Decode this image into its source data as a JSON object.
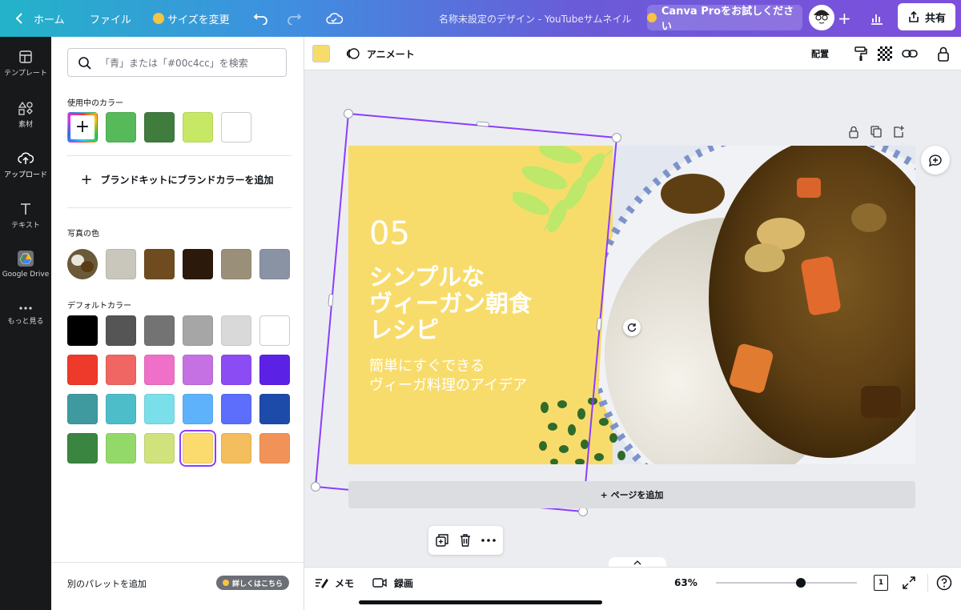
{
  "topbar": {
    "home_label": "ホーム",
    "file_label": "ファイル",
    "resize_label": "サイズを変更",
    "doc_title": "名称未設定のデザイン - YouTubeサムネイル",
    "pro_label": "Canva Proをお試しください",
    "share_label": "共有"
  },
  "leftnav": {
    "items": [
      {
        "label": "テンプレート"
      },
      {
        "label": "素材"
      },
      {
        "label": "アップロード"
      },
      {
        "label": "テキスト"
      },
      {
        "label": "Google Drive"
      },
      {
        "label": "もっと見る"
      }
    ]
  },
  "panel": {
    "search_placeholder": "「青」または「#00c4cc」を検索",
    "in_use_title": "使用中のカラー",
    "in_use_colors": [
      "#56b95a",
      "#3f7c3e",
      "#c7e865",
      "#ffffff"
    ],
    "brand_label": "ブランドキットにブランドカラーを追加",
    "photo_title": "写真の色",
    "photo_colors": [
      "#c9c6bc",
      "#6f4c1f",
      "#2b1a0c",
      "#9a907a",
      "#8a93a4"
    ],
    "default_title": "デフォルトカラー",
    "default_colors": [
      [
        "#000000",
        "#555555",
        "#737373",
        "#a6a6a6",
        "#d9d9d9",
        "#ffffff"
      ],
      [
        "#ee3a2b",
        "#ef6663",
        "#ef70c8",
        "#c571e3",
        "#8b4cf3",
        "#5b22e6"
      ],
      [
        "#3f9aa0",
        "#4dbec9",
        "#7bdfea",
        "#5db2fb",
        "#5c6efb",
        "#1d4ba9"
      ],
      [
        "#3a8540",
        "#93d96a",
        "#cfe27b",
        "#fbdb6e",
        "#f4bd5d",
        "#f19359"
      ]
    ],
    "selected_color": "#fbdb6e",
    "add_palette_label": "別のパレットを追加",
    "learn_more_label": "詳しくはこちら"
  },
  "editbar": {
    "current_color": "#f8dc6b",
    "animate_label": "アニメート",
    "arrange_label": "配置"
  },
  "design": {
    "number": "05",
    "title_line1": "シンプルな",
    "title_line2": "ヴィーガン朝食",
    "title_line3": "レシピ",
    "sub_line1": "簡単にすぐできる",
    "sub_line2": "ヴィーガ料理のアイデア",
    "add_page_label": "+ ページを追加"
  },
  "bottombar": {
    "memo_label": "メモ",
    "record_label": "録画",
    "zoom_label": "63%",
    "zoom_level": 0.6,
    "page_number": "1"
  }
}
